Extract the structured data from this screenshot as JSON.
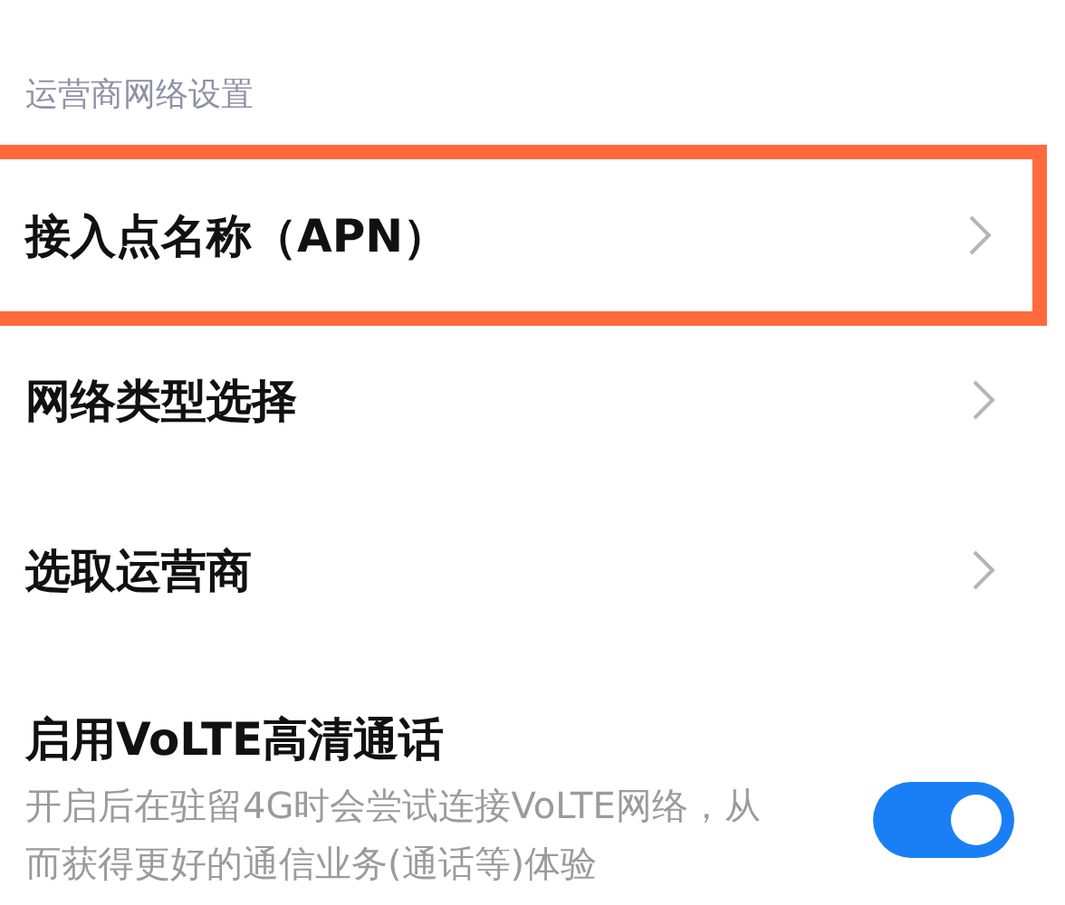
{
  "section_title": "运营商网络设置",
  "items": [
    {
      "kind": "link",
      "label": "接入点名称（APN）",
      "highlighted": true
    },
    {
      "kind": "link",
      "label": "网络类型选择",
      "highlighted": false
    },
    {
      "kind": "link",
      "label": "选取运营商",
      "highlighted": false
    },
    {
      "kind": "toggle",
      "label": "启用VoLTE高清通话",
      "description": "开启后在驻留4G时会尝试连接VoLTE网络，从而获得更好的通信业务(通话等)体验",
      "on": true
    }
  ]
}
